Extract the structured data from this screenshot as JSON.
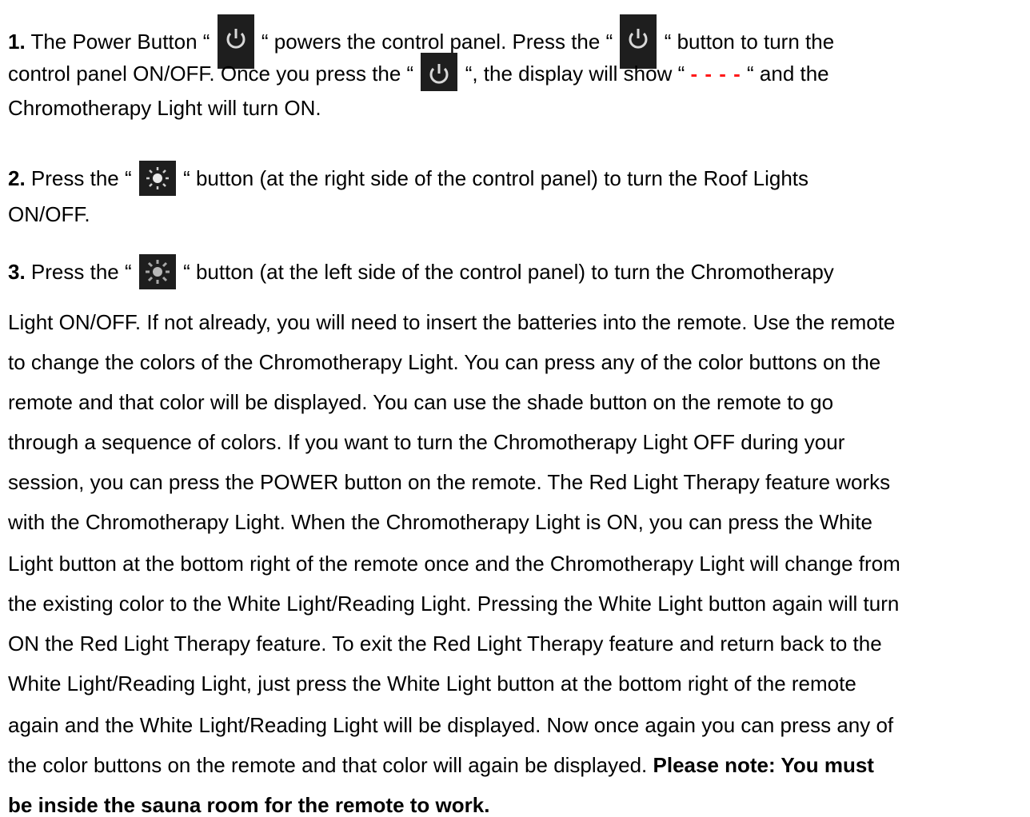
{
  "doc": {
    "p1": {
      "num": "1.",
      "a": " The Power Button “",
      "b": "“ powers the control panel.  Press the “",
      "c": "“ button to turn the",
      "d": "control panel ON/OFF.  Once you press the “",
      "e": "“, the display will show “",
      "display": "- - - -",
      "f": "“ and the",
      "g": "Chromotherapy Light will turn ON."
    },
    "p2": {
      "num": "2.",
      "a": " Press the “",
      "b": "“ button (at the right side of the control panel) to turn the Roof Lights",
      "c": "ON/OFF."
    },
    "p3": {
      "num": "3.",
      "a": " Press the “",
      "b": "“ button (at the left side of the control panel) to turn the Chromotherapy",
      "lines": [
        "Light ON/OFF. If not already, you will need to insert the batteries into the remote.  Use the remote",
        "to change the colors of the Chromotherapy Light. You can press any of the color buttons on the",
        "remote and that color will be displayed.  You can use the shade button on the remote to go",
        "through a sequence of colors.  If you want to turn the Chromotherapy Light OFF during your",
        "session, you can press the POWER button on the remote.  The Red Light Therapy feature works",
        "with the Chromotherapy Light.  When the Chromotherapy Light is ON, you can press the White",
        "Light button at the bottom right of the remote once and the Chromotherapy Light will change from",
        "the existing color to the White Light/Reading Light.  Pressing the White Light button again will turn",
        "ON the Red Light Therapy feature.  To exit the Red Light Therapy feature and return back to the",
        "White Light/Reading Light, just press the White Light button at the bottom right of the remote",
        "again and the White Light/Reading Light will be displayed.  Now once again you can press any of"
      ],
      "last_plain": "the color buttons on the remote and that color will again be displayed.   ",
      "note_a": "Please note: You must",
      "note_b": "be inside the sauna room for the remote to work."
    }
  },
  "icons": {
    "power": "power-icon",
    "roof_light": "sun-icon",
    "chromo_light": "sun-dim-icon"
  },
  "colors": {
    "text": "#000000",
    "display_dashes": "#ff1a1a",
    "icon_bg": "#1e1e1e"
  }
}
